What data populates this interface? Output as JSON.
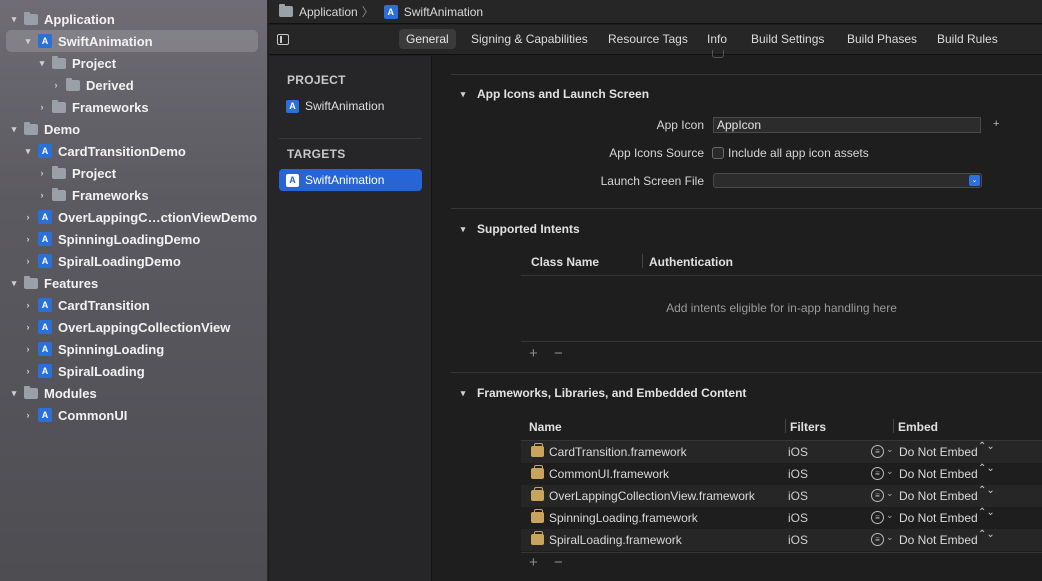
{
  "navigator": {
    "items": [
      {
        "label": "Application",
        "type": "folder",
        "depth": 0,
        "expanded": true,
        "selected": false
      },
      {
        "label": "SwiftAnimation",
        "type": "project",
        "depth": 1,
        "expanded": true,
        "selected": true
      },
      {
        "label": "Project",
        "type": "folder",
        "depth": 2,
        "expanded": true,
        "selected": false
      },
      {
        "label": "Derived",
        "type": "folder",
        "depth": 3,
        "expanded": false,
        "selected": false
      },
      {
        "label": "Frameworks",
        "type": "folder",
        "depth": 2,
        "expanded": false,
        "selected": false
      },
      {
        "label": "Demo",
        "type": "folder",
        "depth": 0,
        "expanded": true,
        "selected": false
      },
      {
        "label": "CardTransitionDemo",
        "type": "project",
        "depth": 1,
        "expanded": true,
        "selected": false
      },
      {
        "label": "Project",
        "type": "folder",
        "depth": 2,
        "expanded": false,
        "selected": false
      },
      {
        "label": "Frameworks",
        "type": "folder",
        "depth": 2,
        "expanded": false,
        "selected": false
      },
      {
        "label": "OverLappingC…ctionViewDemo",
        "type": "project",
        "depth": 1,
        "expanded": false,
        "selected": false
      },
      {
        "label": "SpinningLoadingDemo",
        "type": "project",
        "depth": 1,
        "expanded": false,
        "selected": false
      },
      {
        "label": "SpiralLoadingDemo",
        "type": "project",
        "depth": 1,
        "expanded": false,
        "selected": false
      },
      {
        "label": "Features",
        "type": "folder",
        "depth": 0,
        "expanded": true,
        "selected": false
      },
      {
        "label": "CardTransition",
        "type": "project",
        "depth": 1,
        "expanded": false,
        "selected": false
      },
      {
        "label": "OverLappingCollectionView",
        "type": "project",
        "depth": 1,
        "expanded": false,
        "selected": false
      },
      {
        "label": "SpinningLoading",
        "type": "project",
        "depth": 1,
        "expanded": false,
        "selected": false
      },
      {
        "label": "SpiralLoading",
        "type": "project",
        "depth": 1,
        "expanded": false,
        "selected": false
      },
      {
        "label": "Modules",
        "type": "folder",
        "depth": 0,
        "expanded": true,
        "selected": false
      },
      {
        "label": "CommonUI",
        "type": "project",
        "depth": 1,
        "expanded": false,
        "selected": false
      }
    ]
  },
  "breadcrumb": {
    "folder": "Application",
    "project": "SwiftAnimation",
    "separator": "〉"
  },
  "tabs": [
    "General",
    "Signing & Capabilities",
    "Resource Tags",
    "Info",
    "Build Settings",
    "Build Phases",
    "Build Rules"
  ],
  "active_tab": "General",
  "project_list": {
    "project_header": "PROJECT",
    "project_item": "SwiftAnimation",
    "targets_header": "TARGETS",
    "target_item": "SwiftAnimation"
  },
  "app_icons": {
    "title": "App Icons and Launch Screen",
    "app_icon_label": "App Icon",
    "app_icon_value": "AppIcon",
    "app_icon_add": "+",
    "sources_label": "App Icons Source",
    "sources_checkbox": "Include all app icon assets",
    "launch_label": "Launch Screen File",
    "launch_value": ""
  },
  "intents": {
    "title": "Supported Intents",
    "col_class": "Class Name",
    "col_auth": "Authentication",
    "empty": "Add intents eligible for in-app handling here",
    "add": "+",
    "remove": "−"
  },
  "frameworks": {
    "title": "Frameworks, Libraries, and Embedded Content",
    "col_name": "Name",
    "col_filters": "Filters",
    "col_embed": "Embed",
    "rows": [
      {
        "name": "CardTransition.framework",
        "filter": "iOS",
        "embed": "Do Not Embed"
      },
      {
        "name": "CommonUI.framework",
        "filter": "iOS",
        "embed": "Do Not Embed"
      },
      {
        "name": "OverLappingCollectionView.framework",
        "filter": "iOS",
        "embed": "Do Not Embed"
      },
      {
        "name": "SpinningLoading.framework",
        "filter": "iOS",
        "embed": "Do Not Embed"
      },
      {
        "name": "SpiralLoading.framework",
        "filter": "iOS",
        "embed": "Do Not Embed"
      }
    ],
    "add": "+",
    "remove": "−"
  },
  "icons": {
    "disclosure_open": "▾",
    "disclosure_closed": "›",
    "project_glyph": "A",
    "filter_glyph": "≡",
    "caret": "⌄",
    "stepper": "⌃⌄"
  }
}
